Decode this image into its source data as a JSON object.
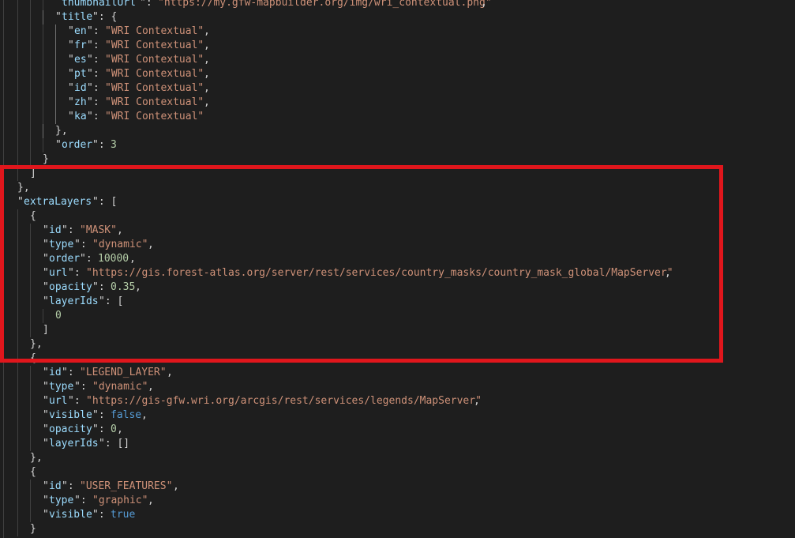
{
  "editor": {
    "theme_colors": {
      "background": "#1e1e1e",
      "key": "#9cdcfe",
      "string": "#ce9178",
      "number": "#b5cea8",
      "keyword": "#569cd6",
      "punctuation": "#d4d4d4",
      "highlight_border": "#e0161c"
    },
    "lines": [
      {
        "guides": 3,
        "active": -1,
        "tokens": [
          [
            "t-key",
            "thumbnailUrl",
            78
          ],
          [
            "t-pun",
            "\":  ",
            177
          ],
          [
            "t-str",
            "\"https://my.gfw-mapbuilder.org/img/wri_contextual.png\"",
            200
          ],
          [
            "t-pun",
            ",",
            609
          ]
        ]
      },
      {
        "guides": 3,
        "active": 2,
        "tokens": [
          [
            "t-pun",
            "\"",
            70
          ],
          [
            "t-key",
            "title",
            78
          ],
          [
            "t-pun",
            "\": {",
            117
          ]
        ]
      },
      {
        "guides": 4,
        "active": 3,
        "tokens": [
          [
            "t-pun",
            "\"",
            86
          ],
          [
            "t-key",
            "en",
            94
          ],
          [
            "t-pun",
            "\": ",
            110
          ],
          [
            "t-str",
            "\"WRI Contextual\"",
            133
          ],
          [
            "t-pun",
            ",",
            258
          ]
        ]
      },
      {
        "guides": 4,
        "active": 3,
        "tokens": [
          [
            "t-pun",
            "\"",
            86
          ],
          [
            "t-key",
            "fr",
            94
          ],
          [
            "t-pun",
            "\": ",
            110
          ],
          [
            "t-str",
            "\"WRI Contextual\"",
            133
          ],
          [
            "t-pun",
            ",",
            258
          ]
        ]
      },
      {
        "guides": 4,
        "active": 3,
        "tokens": [
          [
            "t-pun",
            "\"",
            86
          ],
          [
            "t-key",
            "es",
            94
          ],
          [
            "t-pun",
            "\": ",
            110
          ],
          [
            "t-str",
            "\"WRI Contextual\"",
            133
          ],
          [
            "t-pun",
            ",",
            258
          ]
        ]
      },
      {
        "guides": 4,
        "active": 3,
        "tokens": [
          [
            "t-pun",
            "\"",
            86
          ],
          [
            "t-key",
            "pt",
            94
          ],
          [
            "t-pun",
            "\": ",
            110
          ],
          [
            "t-str",
            "\"WRI Contextual\"",
            133
          ],
          [
            "t-pun",
            ",",
            258
          ]
        ]
      },
      {
        "guides": 4,
        "active": 3,
        "tokens": [
          [
            "t-pun",
            "\"",
            86
          ],
          [
            "t-key",
            "id",
            94
          ],
          [
            "t-pun",
            "\": ",
            110
          ],
          [
            "t-str",
            "\"WRI Contextual\"",
            133
          ],
          [
            "t-pun",
            ",",
            258
          ]
        ]
      },
      {
        "guides": 4,
        "active": 3,
        "tokens": [
          [
            "t-pun",
            "\"",
            86
          ],
          [
            "t-key",
            "zh",
            94
          ],
          [
            "t-pun",
            "\": ",
            110
          ],
          [
            "t-str",
            "\"WRI Contextual\"",
            133
          ],
          [
            "t-pun",
            ",",
            258
          ]
        ]
      },
      {
        "guides": 4,
        "active": 3,
        "tokens": [
          [
            "t-pun",
            "\"",
            86
          ],
          [
            "t-key",
            "ka",
            94
          ],
          [
            "t-pun",
            "\": ",
            110
          ],
          [
            "t-str",
            "\"WRI Contextual\"",
            133
          ]
        ]
      },
      {
        "guides": 3,
        "active": 2,
        "tokens": [
          [
            "t-pun",
            "},",
            70
          ]
        ]
      },
      {
        "guides": 3,
        "active": -1,
        "tokens": [
          [
            "t-pun",
            "\"",
            70
          ],
          [
            "t-key",
            "order",
            78
          ],
          [
            "t-pun",
            "\": ",
            117
          ],
          [
            "t-num",
            "3",
            140
          ]
        ]
      },
      {
        "guides": 2,
        "active": -1,
        "tokens": [
          [
            "t-pun",
            "}",
            54
          ]
        ]
      },
      {
        "guides": 1,
        "active": -1,
        "tokens": [
          [
            "t-pun",
            "]",
            38
          ]
        ]
      },
      {
        "guides": 0,
        "active": -1,
        "tokens": [
          [
            "t-pun",
            "},",
            22
          ]
        ]
      },
      {
        "guides": 0,
        "active": -1,
        "tokens": [
          [
            "t-pun",
            "\"",
            22
          ],
          [
            "t-key",
            "extraLayers",
            30
          ],
          [
            "t-pun",
            "\": [",
            117
          ]
        ]
      },
      {
        "guides": 1,
        "active": -1,
        "tokens": [
          [
            "t-pun",
            "{",
            38
          ]
        ]
      },
      {
        "guides": 2,
        "active": -1,
        "tokens": [
          [
            "t-pun",
            "\"",
            54
          ],
          [
            "t-key",
            "id",
            62
          ],
          [
            "t-pun",
            "\": ",
            78
          ],
          [
            "t-str",
            "\"MASK\"",
            101
          ],
          [
            "t-pun",
            ",",
            148
          ]
        ]
      },
      {
        "guides": 2,
        "active": -1,
        "tokens": [
          [
            "t-pun",
            "\"",
            54
          ],
          [
            "t-key",
            "type",
            62
          ],
          [
            "t-pun",
            "\": ",
            94
          ],
          [
            "t-str",
            "\"dynamic\"",
            117
          ],
          [
            "t-pun",
            ",",
            187
          ]
        ]
      },
      {
        "guides": 2,
        "active": -1,
        "tokens": [
          [
            "t-pun",
            "\"",
            54
          ],
          [
            "t-key",
            "order",
            62
          ],
          [
            "t-pun",
            "\": ",
            101
          ],
          [
            "t-num",
            "10000",
            124
          ],
          [
            "t-pun",
            ",",
            164
          ]
        ]
      },
      {
        "guides": 2,
        "active": -1,
        "tokens": [
          [
            "t-pun",
            "\"",
            54
          ],
          [
            "t-key",
            "url",
            62
          ],
          [
            "t-pun",
            "\": ",
            86
          ],
          [
            "t-str",
            "\"https://gis.forest-atlas.org/server/rest/services/country_masks/country_mask_global/MapServer\"",
            109
          ],
          [
            "t-pun",
            ",",
            842
          ]
        ]
      },
      {
        "guides": 2,
        "active": -1,
        "tokens": [
          [
            "t-pun",
            "\"",
            54
          ],
          [
            "t-key",
            "opacity",
            62
          ],
          [
            "t-pun",
            "\": ",
            117
          ],
          [
            "t-num",
            "0.35",
            140
          ],
          [
            "t-pun",
            ",",
            171
          ]
        ]
      },
      {
        "guides": 2,
        "active": -1,
        "tokens": [
          [
            "t-pun",
            "\"",
            54
          ],
          [
            "t-key",
            "layerIds",
            62
          ],
          [
            "t-pun",
            "\": [",
            125
          ]
        ]
      },
      {
        "guides": 3,
        "active": -1,
        "tokens": [
          [
            "t-num",
            "0",
            70
          ]
        ]
      },
      {
        "guides": 2,
        "active": -1,
        "tokens": [
          [
            "t-pun",
            "]",
            54
          ]
        ]
      },
      {
        "guides": 1,
        "active": -1,
        "tokens": [
          [
            "t-pun",
            "},",
            38
          ]
        ]
      },
      {
        "guides": 1,
        "active": -1,
        "tokens": [
          [
            "t-pun",
            "{",
            38
          ]
        ]
      },
      {
        "guides": 2,
        "active": -1,
        "tokens": [
          [
            "t-pun",
            "\"",
            54
          ],
          [
            "t-key",
            "id",
            62
          ],
          [
            "t-pun",
            "\": ",
            78
          ],
          [
            "t-str",
            "\"LEGEND_LAYER\"",
            101
          ],
          [
            "t-pun",
            ",",
            211
          ]
        ]
      },
      {
        "guides": 2,
        "active": -1,
        "tokens": [
          [
            "t-pun",
            "\"",
            54
          ],
          [
            "t-key",
            "type",
            62
          ],
          [
            "t-pun",
            "\": ",
            94
          ],
          [
            "t-str",
            "\"dynamic\"",
            117
          ],
          [
            "t-pun",
            ",",
            187
          ]
        ]
      },
      {
        "guides": 2,
        "active": -1,
        "tokens": [
          [
            "t-pun",
            "\"",
            54
          ],
          [
            "t-key",
            "url",
            62
          ],
          [
            "t-pun",
            "\": ",
            86
          ],
          [
            "t-str",
            "\"https://gis-gfw.wri.org/arcgis/rest/services/legends/MapServer\"",
            109
          ],
          [
            "t-pun",
            ",",
            600
          ]
        ]
      },
      {
        "guides": 2,
        "active": -1,
        "tokens": [
          [
            "t-pun",
            "\"",
            54
          ],
          [
            "t-key",
            "visible",
            62
          ],
          [
            "t-pun",
            "\": ",
            117
          ],
          [
            "t-kw",
            "false",
            140
          ],
          [
            "t-pun",
            ",",
            179
          ]
        ]
      },
      {
        "guides": 2,
        "active": -1,
        "tokens": [
          [
            "t-pun",
            "\"",
            54
          ],
          [
            "t-key",
            "opacity",
            62
          ],
          [
            "t-pun",
            "\": ",
            117
          ],
          [
            "t-num",
            "0",
            140
          ],
          [
            "t-pun",
            ",",
            148
          ]
        ]
      },
      {
        "guides": 2,
        "active": -1,
        "tokens": [
          [
            "t-pun",
            "\"",
            54
          ],
          [
            "t-key",
            "layerIds",
            62
          ],
          [
            "t-pun",
            "\": []",
            125
          ]
        ]
      },
      {
        "guides": 1,
        "active": -1,
        "tokens": [
          [
            "t-pun",
            "},",
            38
          ]
        ]
      },
      {
        "guides": 1,
        "active": -1,
        "tokens": [
          [
            "t-pun",
            "{",
            38
          ]
        ]
      },
      {
        "guides": 2,
        "active": -1,
        "tokens": [
          [
            "t-pun",
            "\"",
            54
          ],
          [
            "t-key",
            "id",
            62
          ],
          [
            "t-pun",
            "\": ",
            78
          ],
          [
            "t-str",
            "\"USER_FEATURES\"",
            101
          ],
          [
            "t-pun",
            ",",
            219
          ]
        ]
      },
      {
        "guides": 2,
        "active": -1,
        "tokens": [
          [
            "t-pun",
            "\"",
            54
          ],
          [
            "t-key",
            "type",
            62
          ],
          [
            "t-pun",
            "\": ",
            94
          ],
          [
            "t-str",
            "\"graphic\"",
            117
          ],
          [
            "t-pun",
            ",",
            187
          ]
        ]
      },
      {
        "guides": 2,
        "active": -1,
        "tokens": [
          [
            "t-pun",
            "\"",
            54
          ],
          [
            "t-key",
            "visible",
            62
          ],
          [
            "t-pun",
            "\": ",
            117
          ],
          [
            "t-kw",
            "true",
            140
          ]
        ]
      },
      {
        "guides": 1,
        "active": -1,
        "tokens": [
          [
            "t-pun",
            "}",
            38
          ]
        ]
      }
    ]
  }
}
